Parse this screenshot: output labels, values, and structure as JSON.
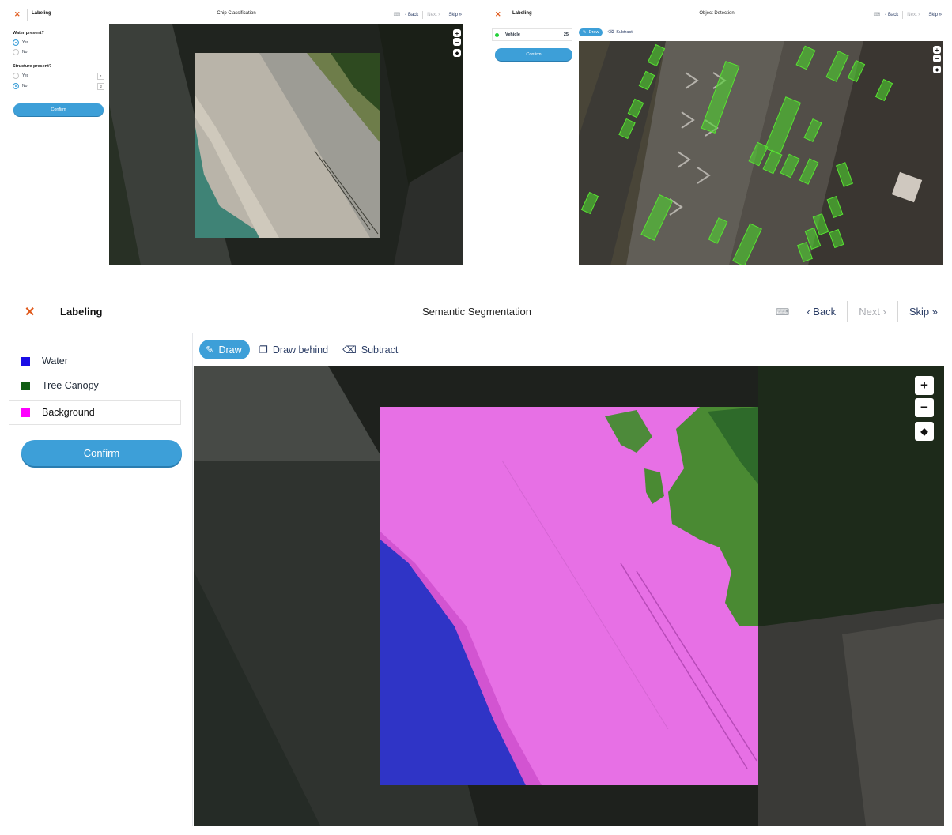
{
  "common": {
    "app_title": "Labeling",
    "close_glyph": "✕",
    "keyboard_glyph": "⌨",
    "back_label": "‹ Back",
    "next_label": "Next ›",
    "skip_label": "Skip »",
    "confirm_label": "Confirm",
    "zoom_in": "+",
    "zoom_out": "−",
    "layers_glyph": "◆"
  },
  "panel_classification": {
    "title": "Chip Classification",
    "questions": [
      {
        "label": "Water present?",
        "options": [
          {
            "label": "Yes",
            "selected": true
          },
          {
            "label": "No",
            "selected": false
          }
        ]
      },
      {
        "label": "Structure present?",
        "options": [
          {
            "label": "Yes",
            "selected": false,
            "shortcut": "1"
          },
          {
            "label": "No",
            "selected": true,
            "shortcut": "2"
          }
        ]
      }
    ]
  },
  "panel_detection": {
    "title": "Object Detection",
    "class_label": "Vehicle",
    "class_count": "25",
    "tools": {
      "draw": "Draw",
      "subtract": "Subtract"
    }
  },
  "panel_segmentation": {
    "title": "Semantic Segmentation",
    "tools": {
      "draw": "Draw",
      "draw_behind": "Draw behind",
      "subtract": "Subtract"
    },
    "classes": [
      {
        "label": "Water",
        "color": "#1a0de6",
        "selected": false
      },
      {
        "label": "Tree Canopy",
        "color": "#0f5c12",
        "selected": false
      },
      {
        "label": "Background",
        "color": "#ff00ff",
        "selected": true
      }
    ]
  },
  "colors": {
    "accent": "#3d9fd8",
    "close": "#e05a1c",
    "vehicle_dot": "#23d13a",
    "vehicle_box": "#4fd22f"
  }
}
